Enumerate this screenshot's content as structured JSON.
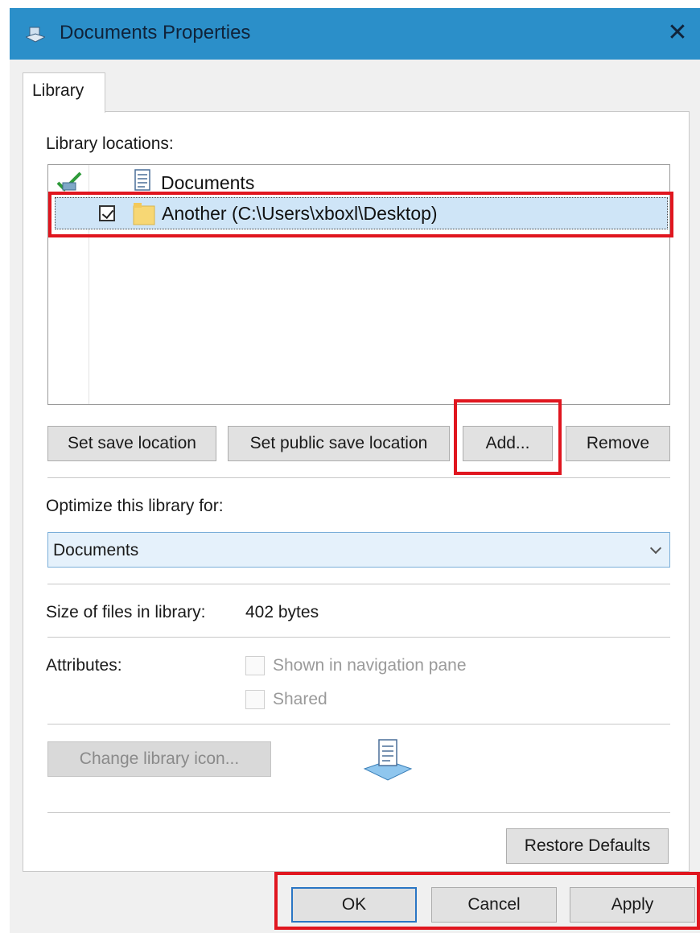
{
  "window": {
    "title": "Documents Properties",
    "close_glyph": "✕",
    "icon": "library-documents-icon"
  },
  "tabs": [
    {
      "label": "Library",
      "active": true
    }
  ],
  "library_locations": {
    "label": "Library locations:",
    "items": [
      {
        "name": "Documents",
        "icon": "documents-library-icon",
        "checked": false,
        "selected": false
      },
      {
        "name": "Another (C:\\Users\\xboxl\\Desktop)",
        "icon": "folder-icon",
        "checked": true,
        "selected": true
      }
    ]
  },
  "location_buttons": {
    "set_save": "Set save location",
    "set_public_save": "Set public save location",
    "add": "Add...",
    "remove": "Remove"
  },
  "optimize": {
    "label": "Optimize this library for:",
    "selected": "Documents"
  },
  "size": {
    "label": "Size of files in library:",
    "value": "402 bytes"
  },
  "attributes": {
    "label": "Attributes:",
    "options": [
      {
        "label": "Shown in navigation pane",
        "checked": false,
        "enabled": false
      },
      {
        "label": "Shared",
        "checked": false,
        "enabled": false
      }
    ]
  },
  "change_icon_button": "Change library icon...",
  "restore_defaults_button": "Restore Defaults",
  "footer": {
    "ok": "OK",
    "cancel": "Cancel",
    "apply": "Apply"
  },
  "colors": {
    "titlebar": "#2b8fc9",
    "selection": "#cfe5f7",
    "highlight": "#e0161f"
  }
}
